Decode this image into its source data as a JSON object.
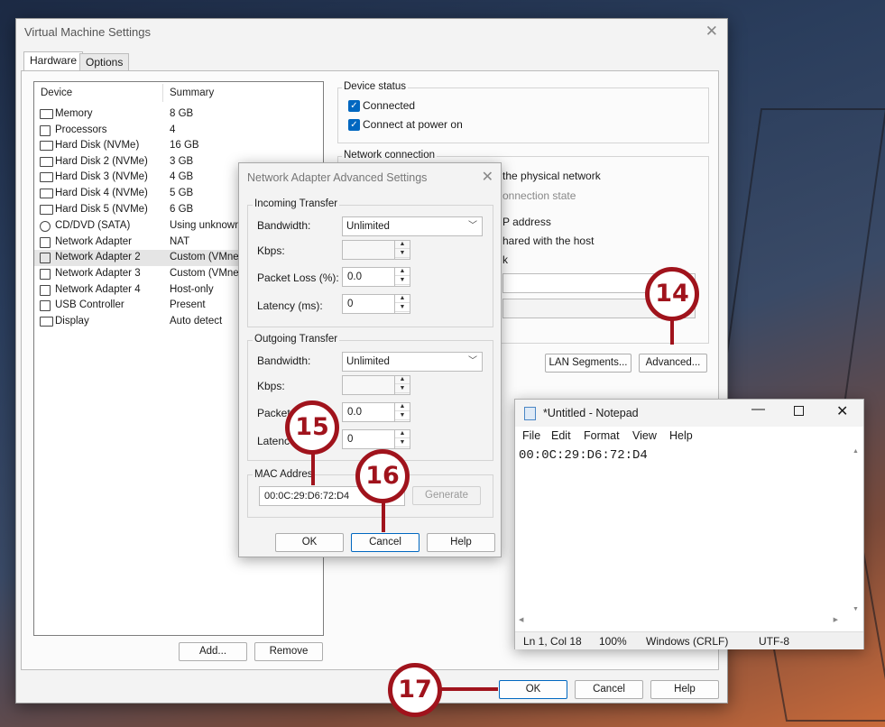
{
  "vm_window": {
    "title": "Virtual Machine Settings",
    "tabs": [
      "Hardware",
      "Options"
    ],
    "device_list": {
      "headers": [
        "Device",
        "Summary"
      ],
      "rows": [
        {
          "icon": "memory-icon",
          "device": "Memory",
          "summary": "8 GB"
        },
        {
          "icon": "processor-icon",
          "device": "Processors",
          "summary": "4"
        },
        {
          "icon": "hard-disk-icon",
          "device": "Hard Disk (NVMe)",
          "summary": "16 GB"
        },
        {
          "icon": "hard-disk-icon",
          "device": "Hard Disk 2 (NVMe)",
          "summary": "3 GB"
        },
        {
          "icon": "hard-disk-icon",
          "device": "Hard Disk 3 (NVMe)",
          "summary": "4 GB"
        },
        {
          "icon": "hard-disk-icon",
          "device": "Hard Disk 4 (NVMe)",
          "summary": "5 GB"
        },
        {
          "icon": "hard-disk-icon",
          "device": "Hard Disk 5 (NVMe)",
          "summary": "6 GB"
        },
        {
          "icon": "cd-dvd-icon",
          "device": "CD/DVD (SATA)",
          "summary": "Using unknown"
        },
        {
          "icon": "network-icon",
          "device": "Network Adapter",
          "summary": "NAT"
        },
        {
          "icon": "network-icon",
          "device": "Network Adapter 2",
          "summary": "Custom (VMnet"
        },
        {
          "icon": "network-icon",
          "device": "Network Adapter 3",
          "summary": "Custom (VMnet"
        },
        {
          "icon": "network-icon",
          "device": "Network Adapter 4",
          "summary": "Host-only"
        },
        {
          "icon": "usb-icon",
          "device": "USB Controller",
          "summary": "Present"
        },
        {
          "icon": "display-icon",
          "device": "Display",
          "summary": "Auto detect"
        }
      ]
    },
    "add_label": "Add...",
    "remove_label": "Remove",
    "device_status": {
      "label": "Device status",
      "connected": "Connected",
      "connect_at_power_on": "Connect at power on"
    },
    "network_connection": {
      "label": "Network connection",
      "visible_fragments": [
        "the physical network",
        "onnection state",
        "P address",
        "hared with the host",
        "k"
      ]
    },
    "lan_segments_label": "LAN Segments...",
    "advanced_label": "Advanced...",
    "ok_label": "OK",
    "cancel_label": "Cancel",
    "help_label": "Help"
  },
  "adv_dialog": {
    "title": "Network Adapter Advanced Settings",
    "incoming": {
      "label": "Incoming Transfer",
      "bandwidth_label": "Bandwidth:",
      "bandwidth_value": "Unlimited",
      "kbps_label": "Kbps:",
      "packet_loss_label": "Packet Loss (%):",
      "packet_loss_value": "0.0",
      "latency_label": "Latency (ms):",
      "latency_value": "0"
    },
    "outgoing": {
      "label": "Outgoing Transfer",
      "bandwidth_label": "Bandwidth:",
      "bandwidth_value": "Unlimited",
      "kbps_label": "Kbps:",
      "packet_loss_label": "Packet",
      "packet_loss_value": "0.0",
      "latency_label": "Latenc",
      "latency_value": "0"
    },
    "mac": {
      "label": "MAC Addres",
      "value": "00:0C:29:D6:72:D4",
      "generate_label": "Generate"
    },
    "ok_label": "OK",
    "cancel_label": "Cancel",
    "help_label": "Help"
  },
  "notepad": {
    "title": "*Untitled - Notepad",
    "menu": [
      "File",
      "Edit",
      "Format",
      "View",
      "Help"
    ],
    "content": "00:0C:29:D6:72:D4",
    "status": {
      "position": "Ln 1, Col 18",
      "zoom": "100%",
      "line_ending": "Windows (CRLF)",
      "encoding": "UTF-8"
    }
  },
  "callouts": [
    "14",
    "15",
    "16",
    "17"
  ],
  "colors": {
    "callout": "#a0131c",
    "accent": "#0067c0"
  }
}
